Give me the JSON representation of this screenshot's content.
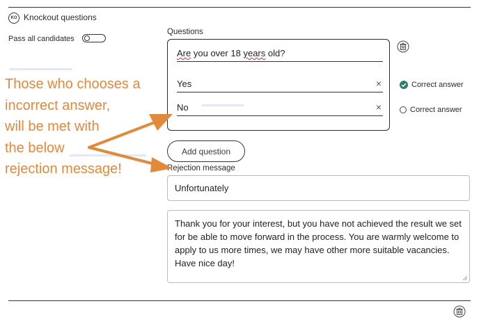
{
  "section": {
    "badge": "KO",
    "title": "Knockout questions"
  },
  "pass_all": {
    "label": "Pass all candidates",
    "enabled": false
  },
  "questions": {
    "label": "Questions",
    "question_text": "Are you over 18 years old?",
    "answers": [
      {
        "text": "Yes",
        "correct": true,
        "radio_label": "Correct answer"
      },
      {
        "text": "No",
        "correct": false,
        "radio_label": "Correct answer"
      }
    ],
    "remove_glyph": "×",
    "add_button": "Add question"
  },
  "rejection": {
    "label": "Rejection message",
    "title_value": "Unfortunately",
    "body_value": "Thank you for your interest, but you have not achieved the result we set for be able to move forward in the process. You are warmly welcome to apply to us more times, we may have other more suitable vacancies. Have nice day!"
  },
  "annotation": {
    "text": "Those who chooses a\nincorrect answer,\nwill be met with\nthe below\nrejection message!",
    "color": "#e2893a"
  },
  "colors": {
    "accent_check": "#2f7d6d",
    "border": "#2b2b2b"
  },
  "icons": {
    "delete": "trash-icon",
    "remove": "close-icon",
    "selected": "check-circle-icon"
  }
}
